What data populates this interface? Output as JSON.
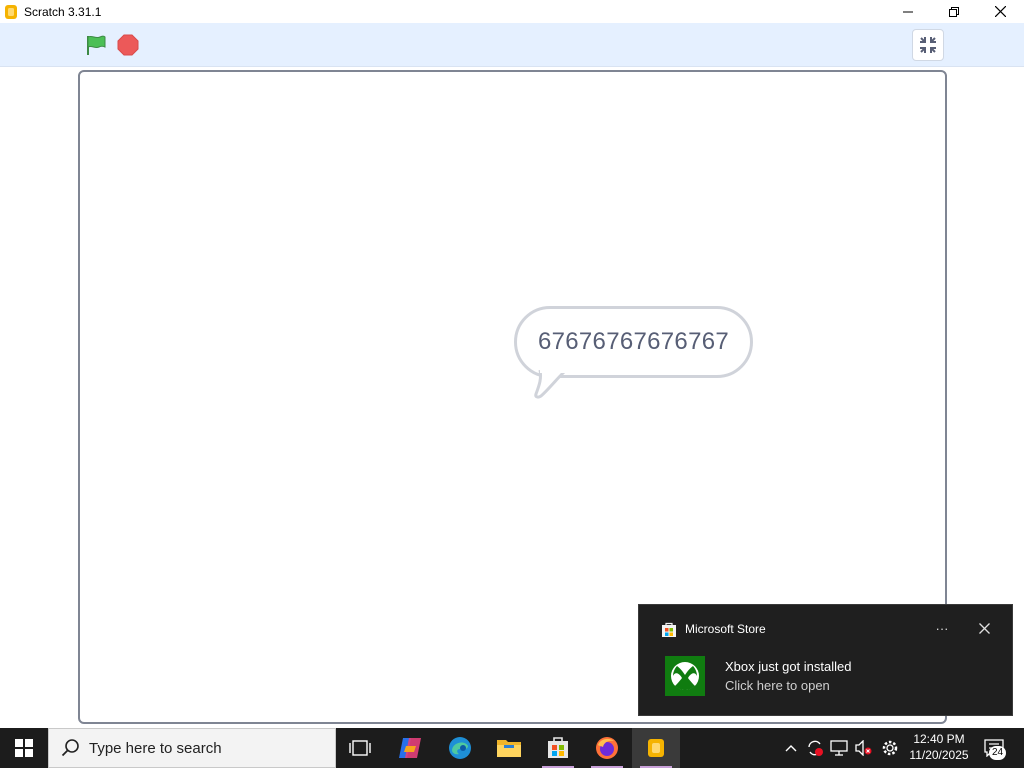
{
  "window": {
    "title": "Scratch 3.31.1",
    "minimize_icon": "minimize-icon",
    "maximize_icon": "restore-icon",
    "close_icon": "close-icon"
  },
  "scratch": {
    "green_flag_icon": "green-flag-icon",
    "stop_icon": "stop-sign-icon",
    "unfullscreen_icon": "unfullscreen-icon",
    "flag_color": "#4cbf56",
    "stop_color": "#ec5959",
    "speech_text": "67676767676767"
  },
  "toast": {
    "app_name": "Microsoft Store",
    "more_label": "···",
    "title": "Xbox just got installed",
    "body": "Click here to open",
    "xbox_color": "#107c10"
  },
  "taskbar": {
    "search_placeholder": "Type here to search",
    "time": "12:40 PM",
    "date": "11/20/2025",
    "notification_count": "24",
    "items": [
      "task-view-icon",
      "copilot-icon",
      "edge-icon",
      "file-explorer-icon",
      "microsoft-store-icon",
      "firefox-icon",
      "scratch-icon"
    ]
  }
}
